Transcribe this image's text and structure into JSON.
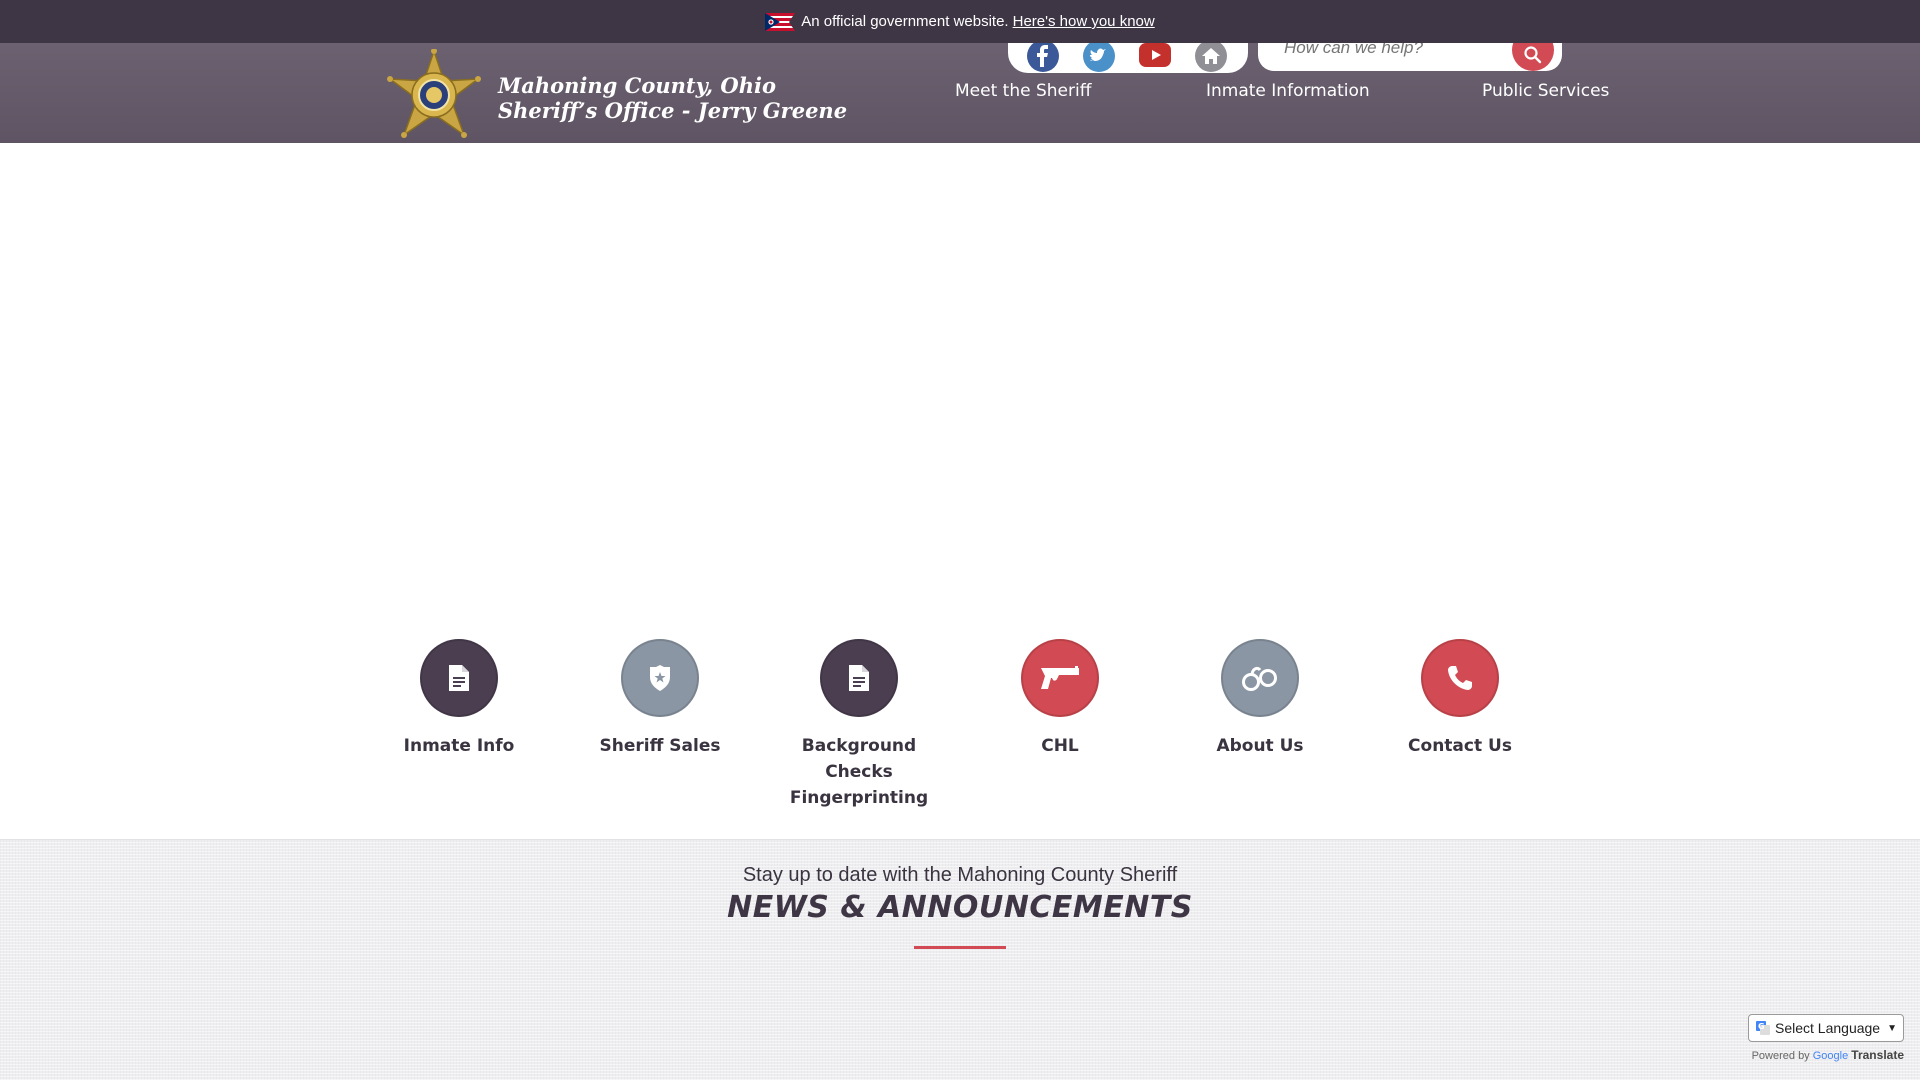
{
  "gov_banner": {
    "text": "An official government website.",
    "link": "Here's how you know"
  },
  "header": {
    "title_line1": "Mahoning County, Ohio",
    "title_line2": "Sheriff’s Office - Jerry Greene",
    "search_placeholder": "How can we help?",
    "social_icons": [
      "facebook-icon",
      "twitter-icon",
      "youtube-icon",
      "home-icon"
    ],
    "nav": [
      "Meet the Sheriff",
      "Inmate Information",
      "Public Services"
    ]
  },
  "quick_links": [
    {
      "label": "Inmate Info",
      "icon": "document-icon",
      "color": "#4a3e50"
    },
    {
      "label": "Sheriff Sales",
      "icon": "badge-icon",
      "color": "#8a96a3"
    },
    {
      "label": "Background Checks Fingerprinting",
      "icon": "document-icon",
      "color": "#4a3e50"
    },
    {
      "label": "CHL",
      "icon": "handgun-icon",
      "color": "#d24a53"
    },
    {
      "label": "About Us",
      "icon": "handcuffs-icon",
      "color": "#8a96a3"
    },
    {
      "label": "Contact Us",
      "icon": "phone-icon",
      "color": "#d24a53"
    }
  ],
  "news": {
    "subtitle": "Stay up to date with the Mahoning County Sheriff",
    "title": "NEWS & ANNOUNCEMENTS"
  },
  "translate": {
    "select_label": "Select Language",
    "powered_by": "Powered by",
    "google": "Google",
    "translate_label": "Translate"
  },
  "colors": {
    "banner_bg": "#3e3545",
    "header_bg": "#635968",
    "accent_red": "#d24a53",
    "dark_purple": "#4a3e50",
    "slate_gray": "#8a96a3"
  }
}
